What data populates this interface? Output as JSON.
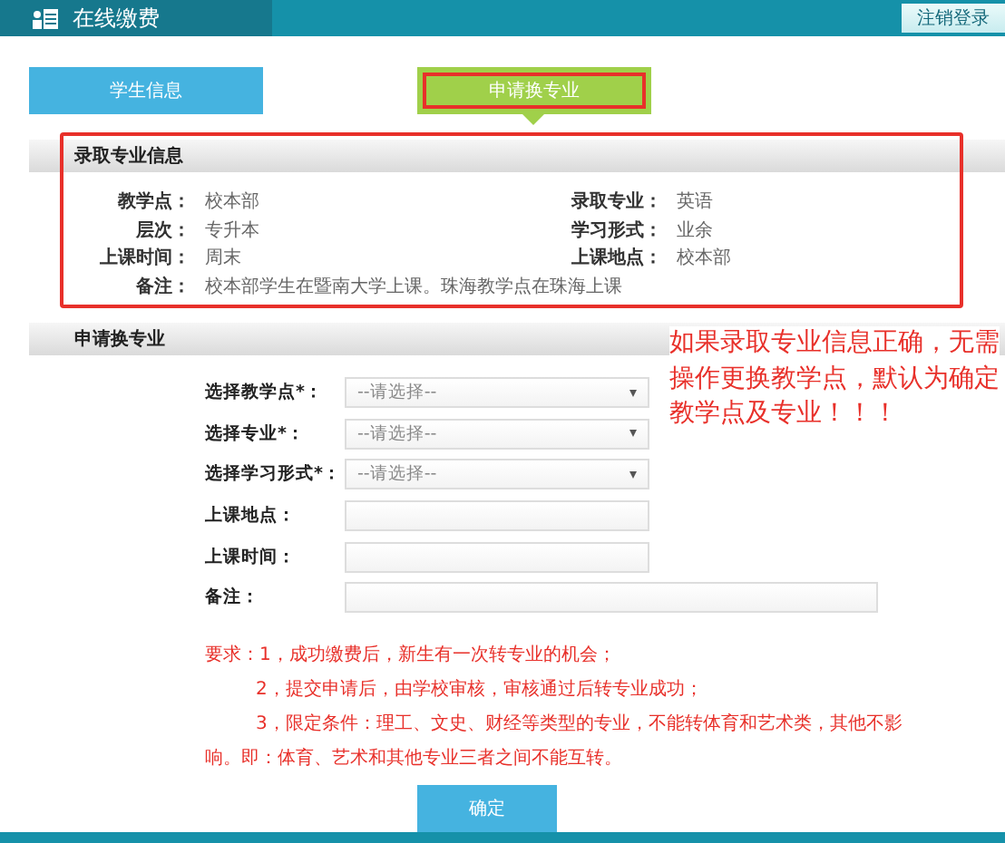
{
  "header": {
    "title": "在线缴费",
    "logout_button": "注销登录"
  },
  "tabs": [
    {
      "label": "学生信息",
      "selected": false,
      "highlighted": false
    },
    {
      "label": "申请换专业",
      "selected": true,
      "highlighted": true
    }
  ],
  "admission_info": {
    "title": "录取专业信息",
    "highlighted": true,
    "rows": [
      [
        {
          "label": "教学点：",
          "value": "校本部"
        },
        {
          "label": "录取专业：",
          "value": "英语"
        }
      ],
      [
        {
          "label": "层次：",
          "value": "专升本"
        },
        {
          "label": "学习形式：",
          "value": "业余"
        }
      ],
      [
        {
          "label": "上课时间：",
          "value": "周末"
        },
        {
          "label": "上课地点：",
          "value": "校本部"
        }
      ],
      [
        {
          "label": "备注：",
          "value": "校本部学生在暨南大学上课。珠海教学点在珠海上课"
        }
      ]
    ]
  },
  "change_form": {
    "title": "申请换专业",
    "note": "如果录取专业信息正确，无需操作更换教学点，默认为确定教学点及专业！！！",
    "fields": [
      {
        "kind": "select",
        "label": "选择教学点*：",
        "placeholder": "--请选择--"
      },
      {
        "kind": "select",
        "label": "选择专业*：",
        "placeholder": "--请选择--"
      },
      {
        "kind": "select",
        "label": "选择学习形式*：",
        "placeholder": "--请选择--"
      },
      {
        "kind": "text",
        "label": "上课地点："
      },
      {
        "kind": "text",
        "label": "上课时间："
      },
      {
        "kind": "wide_text",
        "label": "备注："
      }
    ],
    "requirements": [
      "要求：1，成功缴费后，新生有一次转专业的机会；",
      "2，提交申请后，由学校审核，审核通过后转专业成功；",
      "3，限定条件：理工、文史、财经等类型的专业，不能转体育和艺术类，其他不影响。即：体育、艺术和其他专业三者之间不能互转。"
    ],
    "submit_button": "确定"
  }
}
